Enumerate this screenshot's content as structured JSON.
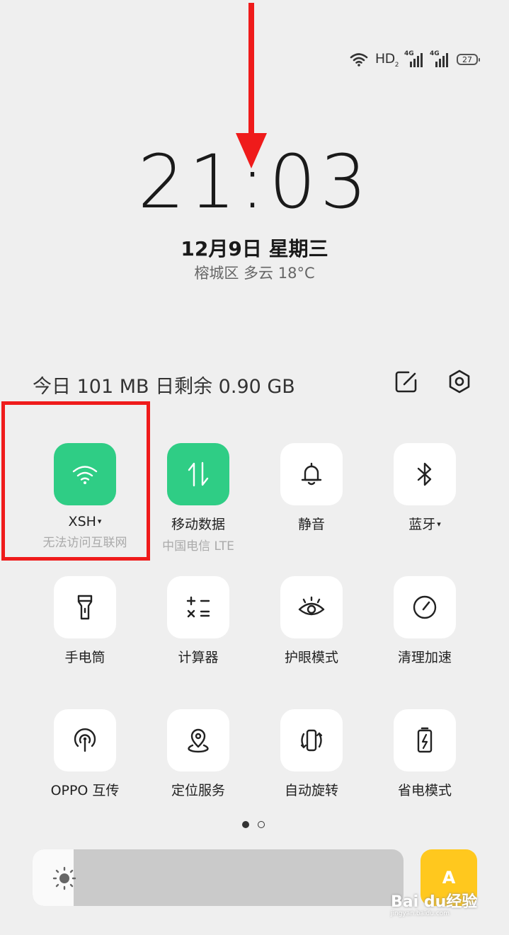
{
  "status_bar": {
    "hd_label": "HD",
    "hd_sub": "2",
    "sim1_label": "4G",
    "sim2_label": "4G",
    "battery": "27"
  },
  "clock": {
    "time": "21:03",
    "date": "12月9日  星期三",
    "weather": "榕城区 多云 18°C"
  },
  "data_usage": {
    "text": "今日 101 MB  日剩余 0.90 GB"
  },
  "tiles": [
    {
      "label": "XSH",
      "sub": "无法访问互联网",
      "icon": "wifi-icon",
      "active": true,
      "caret": "▾"
    },
    {
      "label": "移动数据",
      "sub": "中国电信 LTE",
      "icon": "mobile-data-icon",
      "active": true
    },
    {
      "label": "静音",
      "icon": "bell-icon",
      "active": false
    },
    {
      "label": "蓝牙",
      "icon": "bluetooth-icon",
      "active": false,
      "caret": "▾"
    },
    {
      "label": "手电筒",
      "icon": "flashlight-icon",
      "active": false
    },
    {
      "label": "计算器",
      "icon": "calculator-icon",
      "active": false
    },
    {
      "label": "护眼模式",
      "icon": "eye-icon",
      "active": false
    },
    {
      "label": "清理加速",
      "icon": "speedometer-icon",
      "active": false
    },
    {
      "label": "OPPO 互传",
      "icon": "oppo-share-icon",
      "active": false
    },
    {
      "label": "定位服务",
      "icon": "location-icon",
      "active": false
    },
    {
      "label": "自动旋转",
      "icon": "rotate-icon",
      "active": false
    },
    {
      "label": "省电模式",
      "icon": "battery-saver-icon",
      "active": false
    }
  ],
  "pager": {
    "current": 1,
    "total": 2
  },
  "brightness": {
    "level": 0.11,
    "auto_label": "A"
  },
  "watermark": {
    "brand": "Bai du经验",
    "url": "jingyan.baidu.com"
  },
  "colors": {
    "accent": "#2fcd85",
    "highlight": "#ef1b1b",
    "auto": "#ffc81e"
  }
}
